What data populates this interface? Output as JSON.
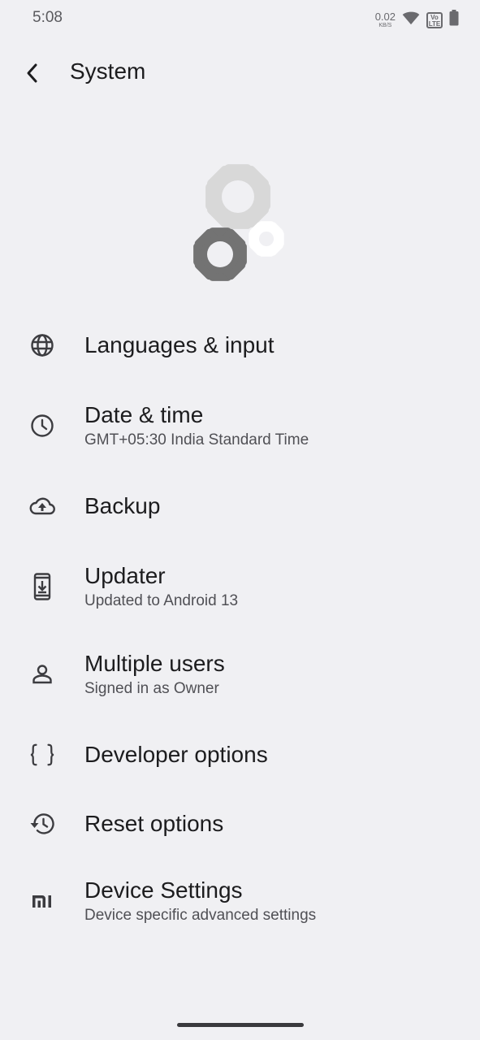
{
  "status_bar": {
    "time": "5:08",
    "net_speed_value": "0.02",
    "net_speed_unit": "KB/S",
    "volte_line1": "Vo",
    "volte_line2": "LTE"
  },
  "header": {
    "title": "System"
  },
  "items": [
    {
      "title": "Languages & input",
      "summary": "",
      "icon": "globe-icon"
    },
    {
      "title": "Date & time",
      "summary": "GMT+05:30 India Standard Time",
      "icon": "clock-icon"
    },
    {
      "title": "Backup",
      "summary": "",
      "icon": "cloud-upload-icon"
    },
    {
      "title": "Updater",
      "summary": "Updated to Android 13",
      "icon": "system-update-icon"
    },
    {
      "title": "Multiple users",
      "summary": "Signed in as Owner",
      "icon": "person-icon"
    },
    {
      "title": "Developer options",
      "summary": "",
      "icon": "braces-icon"
    },
    {
      "title": "Reset options",
      "summary": "",
      "icon": "history-icon"
    },
    {
      "title": "Device Settings",
      "summary": "Device specific advanced settings",
      "icon": "mi-logo-icon"
    }
  ],
  "colors": {
    "background": "#f0f0f3",
    "text_primary": "#1c1c1e",
    "text_secondary": "#505055",
    "icon": "#3c3c40",
    "gear_light": "#d8d8d8",
    "gear_dark": "#737373",
    "gear_white": "#ffffff"
  }
}
